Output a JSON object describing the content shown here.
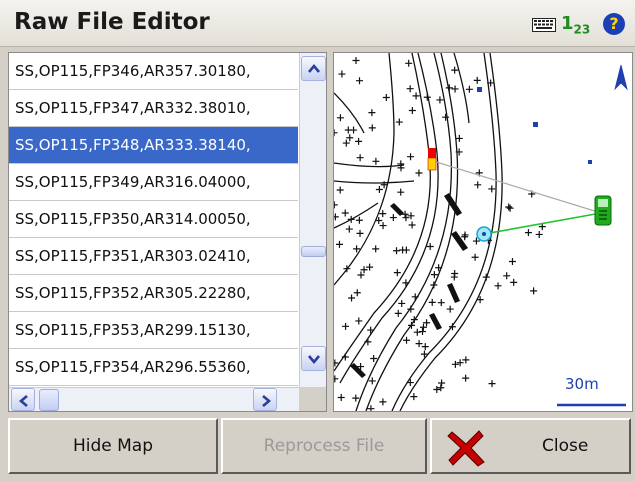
{
  "window": {
    "title": "Raw File Editor"
  },
  "status": {
    "input_mode": "1",
    "input_mode_sub": "23",
    "help": "?"
  },
  "list": {
    "rows": [
      "SS,OP115,FP346,AR357.30180,",
      "SS,OP115,FP347,AR332.38010,",
      "SS,OP115,FP348,AR333.38140,",
      "SS,OP115,FP349,AR316.04000,",
      "SS,OP115,FP350,AR314.00050,",
      "SS,OP115,FP351,AR303.02410,",
      "SS,OP115,FP352,AR305.22280,",
      "SS,OP115,FP353,AR299.15130,",
      "SS,OP115,FP354,AR296.55360,"
    ],
    "selected_index": 2
  },
  "map": {
    "scale_label": "30m",
    "north_label": "N"
  },
  "buttons": {
    "hide_map": "Hide Map",
    "reprocess": "Reprocess File",
    "close": "Close"
  },
  "colors": {
    "selection": "#3a68c8",
    "scale": "#1f3fb0",
    "link_line": "#21c42f",
    "instrument": "#1faa1f"
  }
}
